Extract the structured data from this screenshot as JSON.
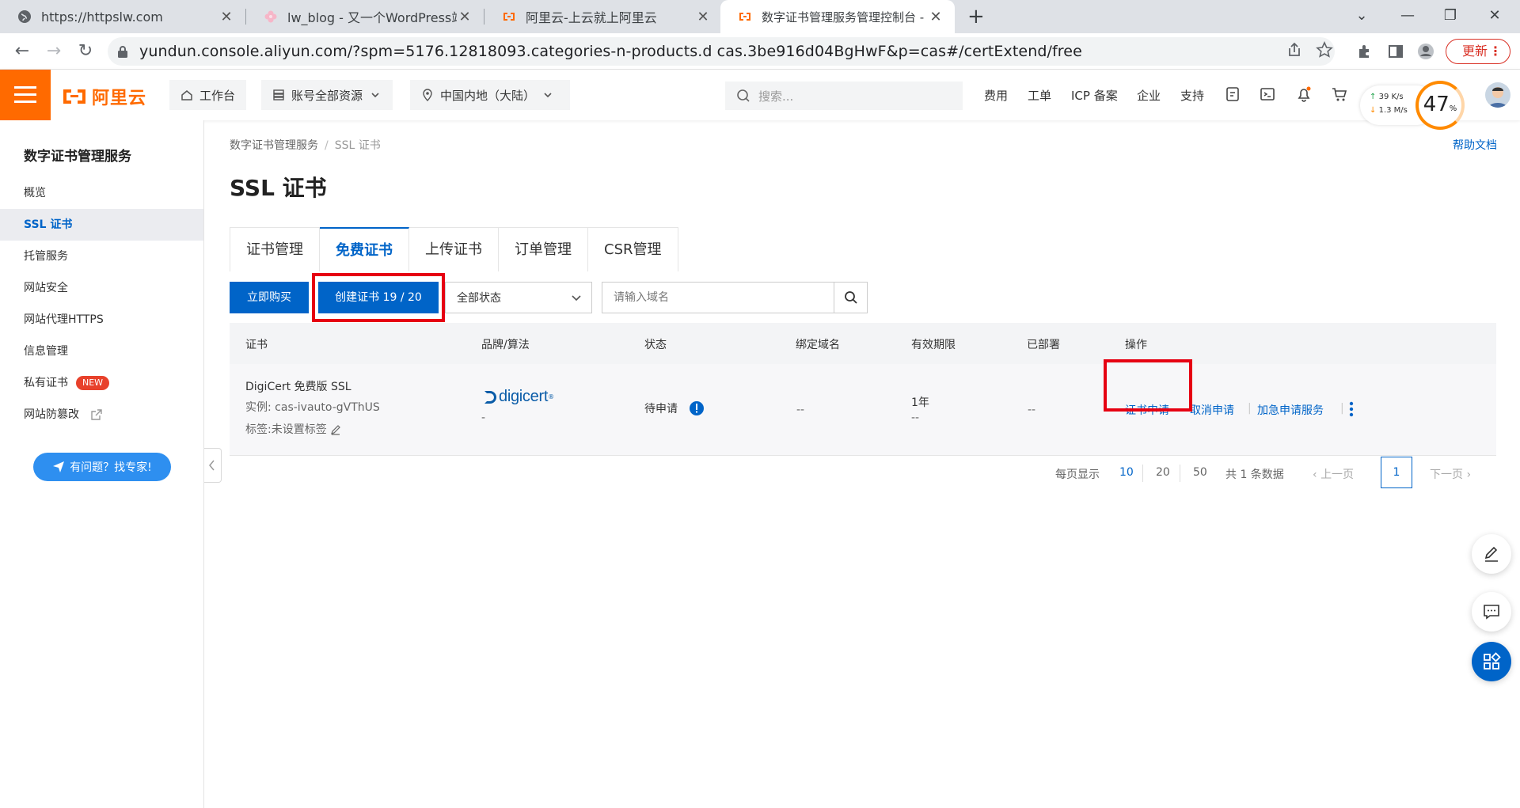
{
  "browser": {
    "tabs": [
      {
        "title": "https://httpslw.com"
      },
      {
        "title": "lw_blog - 又一个WordPress站点"
      },
      {
        "title": "阿里云-上云就上阿里云"
      },
      {
        "title": "数字证书管理服务管理控制台 - S"
      }
    ],
    "url": "yundun.console.aliyun.com/?spm=5176.12818093.categories-n-products.d cas.3be916d04BgHwF&p=cas#/certExtend/free",
    "update_label": "更新"
  },
  "topnav": {
    "logo_text": "阿里云",
    "workbench": "工作台",
    "resources": "账号全部资源",
    "region": "中国内地（大陆）",
    "search_placeholder": "搜索...",
    "links": [
      "费用",
      "工单",
      "ICP 备案",
      "企业",
      "支持"
    ],
    "net_up": "39  K/s",
    "net_down": "1.3  M/s",
    "gauge_value": "47",
    "gauge_unit": "%"
  },
  "sidebar": {
    "service_title": "数字证书管理服务",
    "items": [
      "概览",
      "SSL 证书",
      "托管服务",
      "网站安全",
      "网站代理HTTPS",
      "信息管理",
      "私有证书",
      "网站防篡改"
    ],
    "new_badge": "NEW",
    "ask_button": "有问题？找专家!"
  },
  "main": {
    "breadcrumb": [
      "数字证书管理服务",
      "SSL 证书"
    ],
    "help_doc": "帮助文档",
    "title": "SSL 证书",
    "tabs": [
      "证书管理",
      "免费证书",
      "上传证书",
      "订单管理",
      "CSR管理"
    ],
    "buy_button": "立即购买",
    "create_button": "创建证书 19 / 20",
    "status_select": "全部状态",
    "domain_placeholder": "请输入域名",
    "columns": [
      "证书",
      "品牌/算法",
      "状态",
      "绑定域名",
      "有效期限",
      "已部署",
      "操作"
    ],
    "row": {
      "cert_name": "DigiCert 免费版 SSL",
      "instance": "实例: cas-ivauto-gVThUS",
      "tag": "标签:未设置标签",
      "brand_logo": "digicert",
      "brand_dash": "-",
      "status": "待申请",
      "domain": "--",
      "validity": "1年",
      "validity_sub": "--",
      "deployed": "--",
      "actions": [
        "证书申请",
        "取消申请",
        "加急申请服务"
      ]
    },
    "pager": {
      "per_page_label": "每页显示",
      "sizes": [
        "10",
        "20",
        "50"
      ],
      "total": "共 1 条数据",
      "prev": "上一页",
      "page": "1",
      "next": "下一页"
    }
  }
}
